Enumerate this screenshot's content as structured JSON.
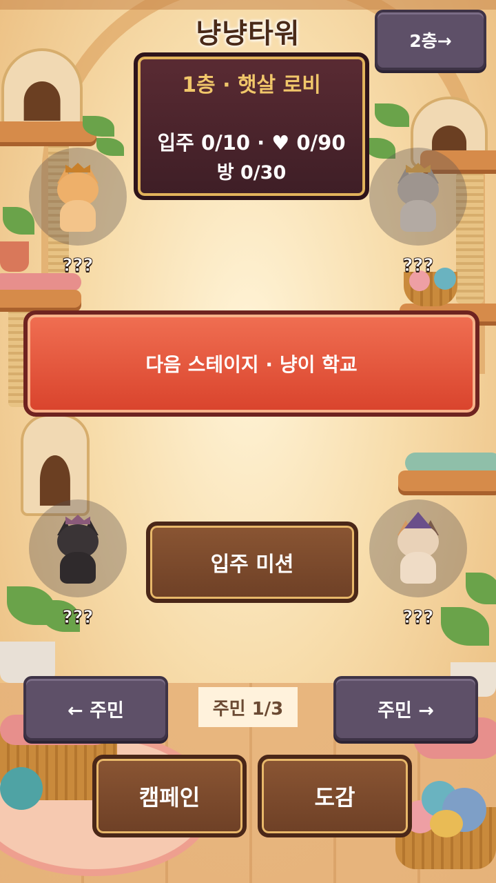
{
  "title": "냥냥타워",
  "floor_nav": {
    "next_floor_label": "2층→"
  },
  "floor_panel": {
    "floor_name": "1층 · 햇살 로비",
    "stats_line": "입주 0/10 · ♥ 0/90",
    "rooms_line": "방 0/30"
  },
  "resident_slots": [
    {
      "label": "???",
      "cat": "orange-tabby-crown"
    },
    {
      "label": "???",
      "cat": "gray-tabby-crown"
    },
    {
      "label": "???",
      "cat": "tuxedo-tiara"
    },
    {
      "label": "???",
      "cat": "calico-witch-hat"
    }
  ],
  "next_stage_button": "다음 스테이지 · 냥이 학교",
  "mission_button": "입주 미션",
  "resident_pager": {
    "prev_label": "← 주민",
    "indicator": "주민 1/3",
    "next_label": "주민 →"
  },
  "bottom_buttons": {
    "campaign": "캠페인",
    "collection": "도감"
  },
  "colors": {
    "accent_red": "#e55a40",
    "panel_dark": "#4a2430",
    "gold": "#f0c66a",
    "brown_button": "#7a4a2c",
    "purple_button": "#5e5068"
  }
}
